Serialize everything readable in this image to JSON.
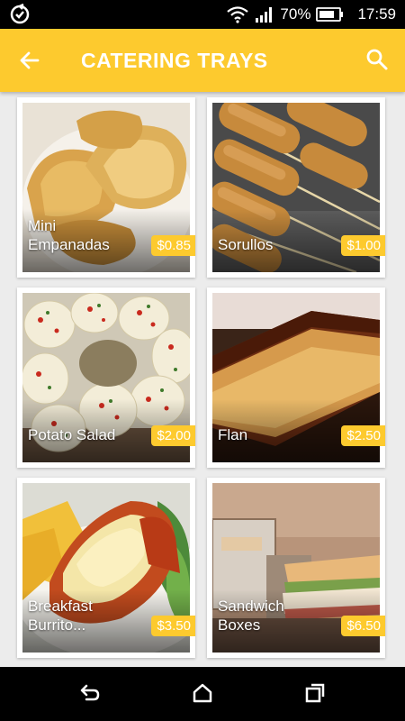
{
  "status_bar": {
    "battery_percent": "70%",
    "time": "17:59",
    "icons": [
      "sync-icon",
      "wifi-icon",
      "signal-icon",
      "battery-icon"
    ]
  },
  "app_bar": {
    "title": "CATERING TRAYS",
    "back_icon": "arrow-left-icon",
    "search_icon": "search-icon",
    "color": "#fdca2e"
  },
  "items": [
    {
      "name": "Mini\nEmpanadas",
      "price": "$0.85"
    },
    {
      "name": "Sorullos",
      "price": "$1.00"
    },
    {
      "name": "Potato Salad",
      "price": "$2.00"
    },
    {
      "name": "Flan",
      "price": "$2.50"
    },
    {
      "name": "Breakfast\nBurrito...",
      "price": "$3.50"
    },
    {
      "name": "Sandwich\nBoxes",
      "price": "$6.50"
    }
  ],
  "nav_bar": {
    "icons": [
      "back-nav-icon",
      "home-icon",
      "recent-apps-icon"
    ]
  }
}
